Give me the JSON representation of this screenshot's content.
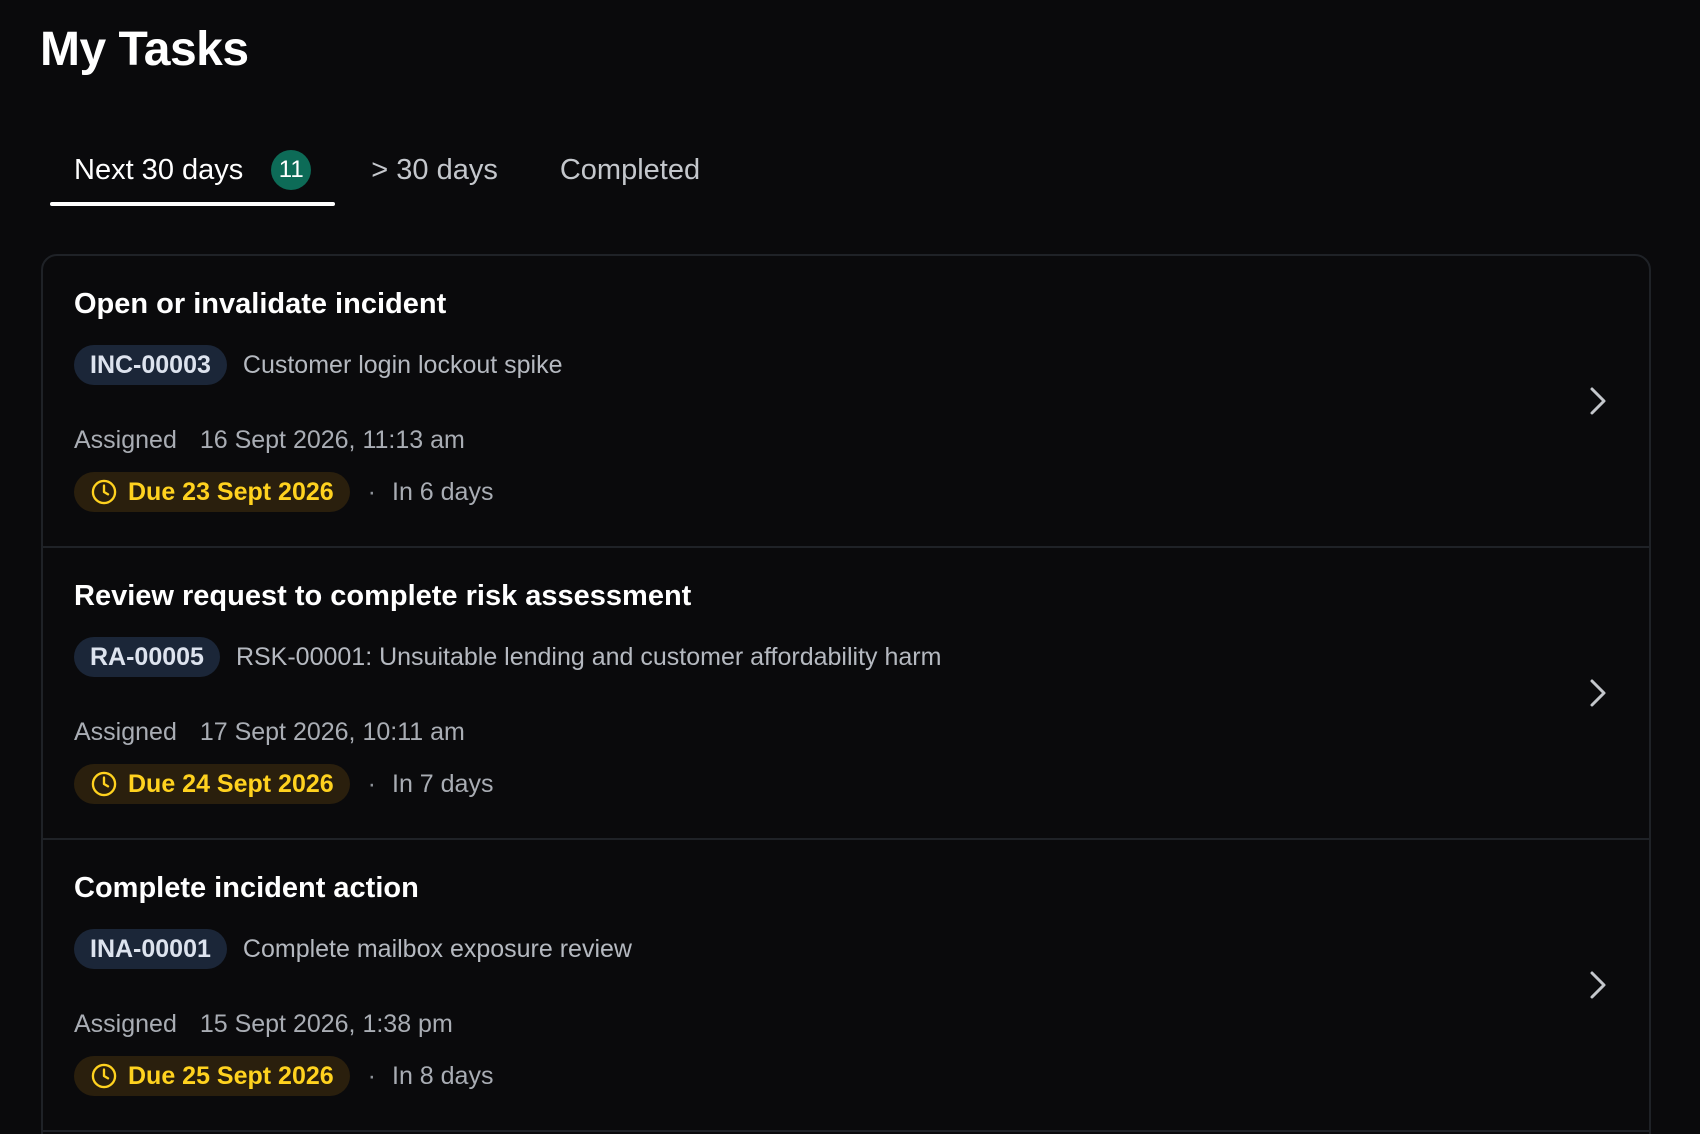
{
  "page": {
    "title": "My Tasks"
  },
  "tabs": [
    {
      "label": "Next 30 days",
      "badge": "11",
      "active": true
    },
    {
      "label": "> 30 days",
      "active": false
    },
    {
      "label": "Completed",
      "active": false
    }
  ],
  "colors": {
    "background": "#0a0a0c",
    "badge": "#0d6b57",
    "ref_tag_bg": "#1b2638",
    "due_pill_bg": "#2a1f0d",
    "due_text": "#ffd21f"
  },
  "icons": {
    "due": "clock-icon",
    "open": "chevron-right-icon"
  },
  "tasks": [
    {
      "title": "Open or invalidate incident",
      "ref_id": "INC-00003",
      "ref_description": "Customer login lockout spike",
      "assigned_label": "Assigned",
      "assigned_at": "16 Sept 2026, 11:13 am",
      "due_label": "Due 23 Sept 2026",
      "separator": "·",
      "due_relative": "In 6 days"
    },
    {
      "title": "Review request to complete risk assessment",
      "ref_id": "RA-00005",
      "ref_description": "RSK-00001: Unsuitable lending and customer affordability harm",
      "assigned_label": "Assigned",
      "assigned_at": "17 Sept 2026, 10:11 am",
      "due_label": "Due 24 Sept 2026",
      "separator": "·",
      "due_relative": "In 7 days"
    },
    {
      "title": "Complete incident action",
      "ref_id": "INA-00001",
      "ref_description": "Complete mailbox exposure review",
      "assigned_label": "Assigned",
      "assigned_at": "15 Sept 2026, 1:38 pm",
      "due_label": "Due 25 Sept 2026",
      "separator": "·",
      "due_relative": "In 8 days"
    }
  ]
}
